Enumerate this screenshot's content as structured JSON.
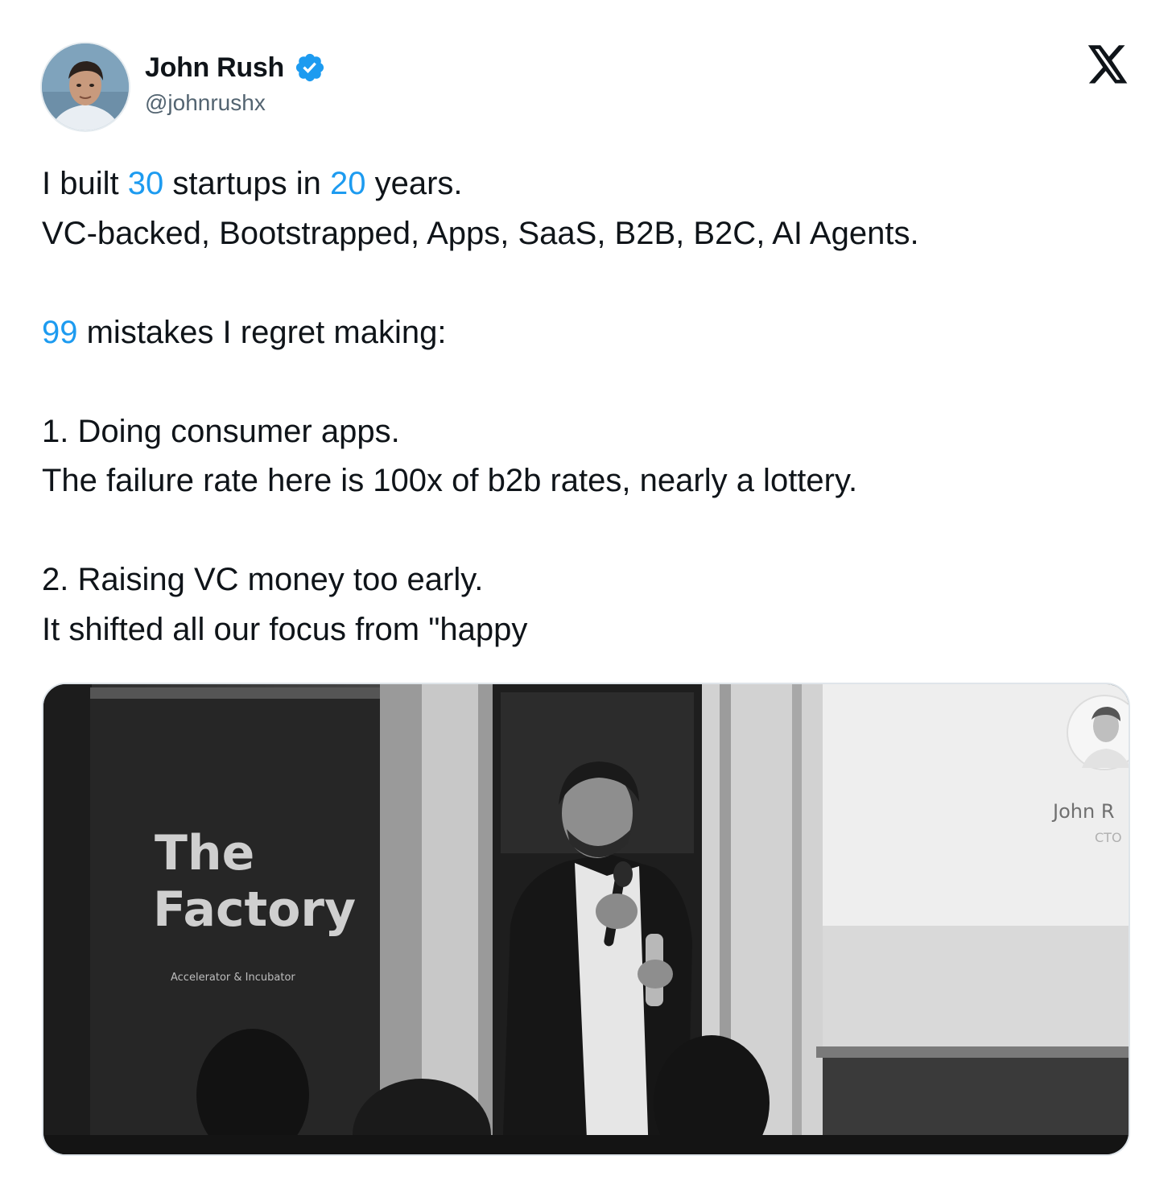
{
  "author": {
    "display_name": "John Rush",
    "handle": "@johnrushx",
    "verified_icon": "verified-badge-icon",
    "avatar_icon": "avatar-photo"
  },
  "platform": {
    "logo_icon": "x-logo-icon"
  },
  "tweet": {
    "line1": {
      "a": "I built ",
      "n1": "30",
      "b": " startups in ",
      "n2": "20",
      "c": " years."
    },
    "line2": "VC-backed, Bootstrapped, Apps, SaaS, B2B, B2C, AI Agents.",
    "line4": {
      "n": "99",
      "rest": " mistakes I regret making:"
    },
    "line6": "1. Doing consumer apps.",
    "line7": "The failure rate here is 100x of b2b rates, nearly a lottery.",
    "line9": "2. Raising VC money too early.",
    "line10": "It shifted all our focus from \"happy"
  },
  "media": {
    "banner_title_line1": "The",
    "banner_title_line2": "Factory",
    "banner_subtitle": "Accelerator & Incubator",
    "screen_name": "John R",
    "screen_role": "CTO"
  },
  "colors": {
    "link_blue": "#1d9bf0",
    "text": "#0f1419",
    "secondary": "#536471"
  }
}
